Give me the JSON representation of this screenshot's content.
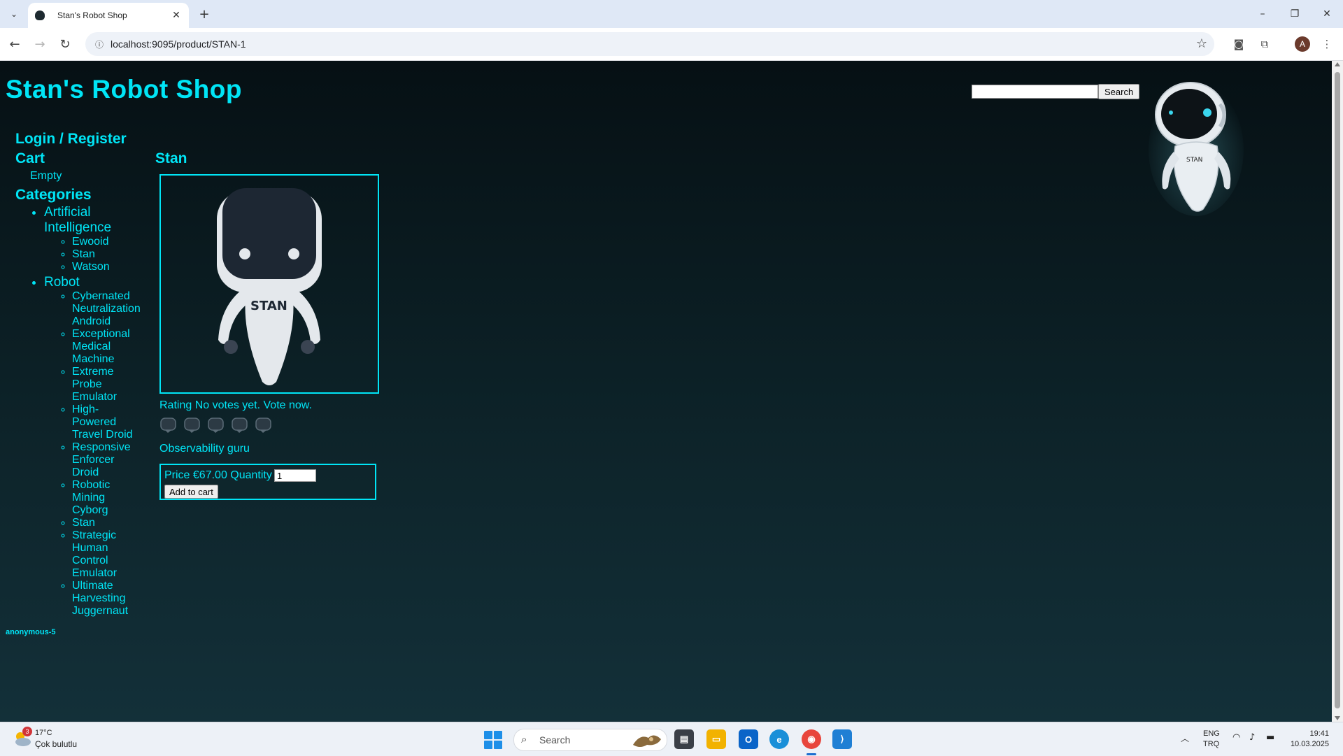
{
  "browser": {
    "tab_title": "Stan's Robot Shop",
    "url": "localhost:9095/product/STAN-1",
    "profile_initial": "A"
  },
  "header": {
    "shop_title": "Stan's Robot Shop",
    "search_placeholder": "",
    "search_button": "Search"
  },
  "sidebar": {
    "login_register": "Login / Register",
    "cart_heading": "Cart",
    "cart_status": "Empty",
    "categories_heading": "Categories",
    "categories": [
      {
        "name": "Artificial Intelligence",
        "items": [
          "Ewooid",
          "Stan",
          "Watson"
        ]
      },
      {
        "name": "Robot",
        "items": [
          "Cybernated Neutralization Android",
          "Exceptional Medical Machine",
          "Extreme Probe Emulator",
          "High-Powered Travel Droid",
          "Responsive Enforcer Droid",
          "Robotic Mining Cyborg",
          "Stan",
          "Strategic Human Control Emulator",
          "Ultimate Harvesting Juggernaut"
        ]
      }
    ],
    "user": "anonymous-5"
  },
  "product": {
    "name": "Stan",
    "image_label": "STAN",
    "mascot_label": "STAN",
    "rating_text": "Rating No votes yet. Vote now.",
    "vote_count": 5,
    "description": "Observability guru",
    "price_text": "Price €67.00 Quantity",
    "quantity": "1",
    "add_to_cart": "Add to cart"
  },
  "taskbar": {
    "weather_temp": "17°C",
    "weather_desc": "Çok bulutlu",
    "weather_badge": "3",
    "search_text": "Search",
    "lang_top": "ENG",
    "lang_bottom": "TRQ",
    "time": "19:41",
    "date": "10.03.2025"
  },
  "colors": {
    "accent": "#00e5f6",
    "page_background": "#0b1a1f"
  }
}
